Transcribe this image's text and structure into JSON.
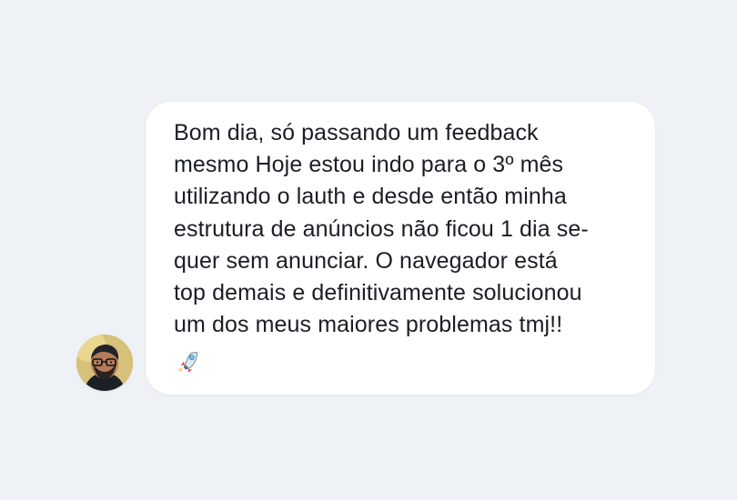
{
  "message": {
    "text": "Bom dia, só passando um feedback\nmesmo Hoje estou indo para o 3º mês\nutilizando o lauth e desde então minha\nestrutura de anúncios não ficou 1 dia se-\nquer sem anunciar. O navegador está\ntop demais e definitivamente solucionou\num dos meus maiores problemas tmj!!"
  },
  "icons": {
    "avatar": "avatar",
    "rocket": "rocket-icon"
  },
  "colors": {
    "page_background": "#eef1f5",
    "bubble_background": "#ffffff",
    "text": "#1b1e25"
  }
}
